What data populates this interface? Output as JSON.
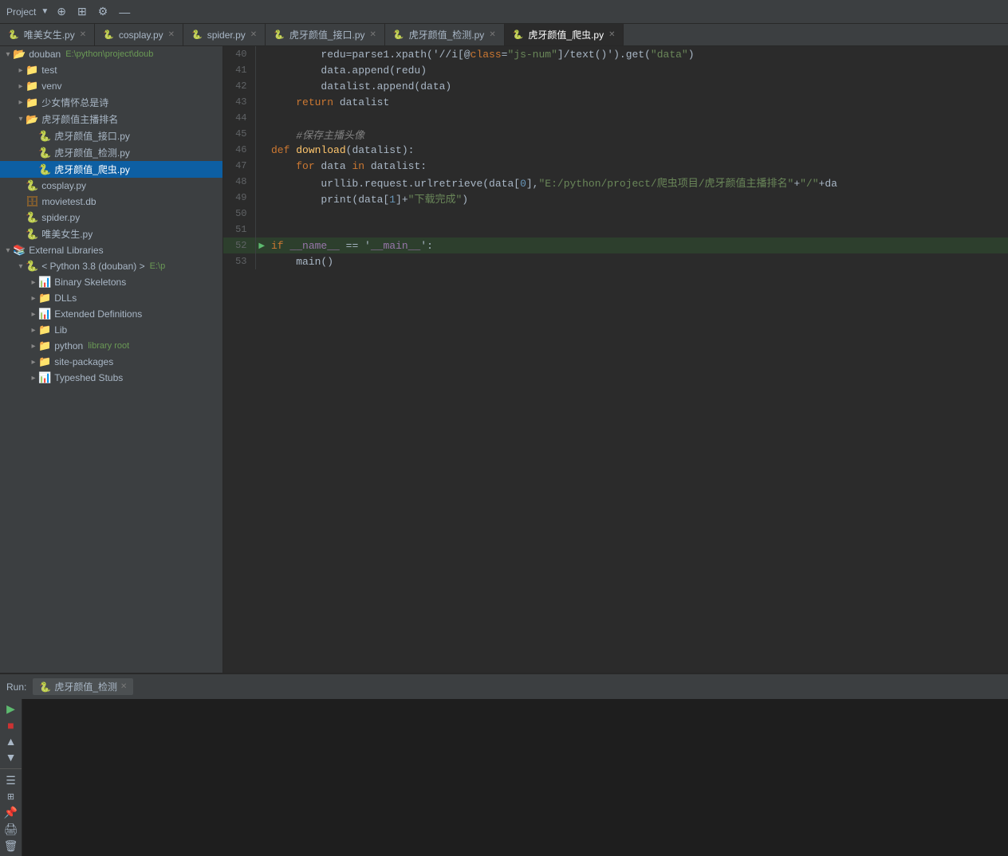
{
  "topbar": {
    "project_label": "Project",
    "icons": [
      "⊕",
      "⊞",
      "⚙",
      "—"
    ]
  },
  "tabs": [
    {
      "label": "唯美女生.py",
      "active": false,
      "icon": "🐍"
    },
    {
      "label": "cosplay.py",
      "active": false,
      "icon": "🐍"
    },
    {
      "label": "spider.py",
      "active": false,
      "icon": "🐍"
    },
    {
      "label": "虎牙颜值_接口.py",
      "active": false,
      "icon": "🐍"
    },
    {
      "label": "虎牙颜值_检测.py",
      "active": false,
      "icon": "🐍"
    },
    {
      "label": "虎牙颜值_爬虫.py",
      "active": true,
      "icon": "🐍"
    }
  ],
  "sidebar": {
    "items": [
      {
        "id": "douban",
        "label": "douban",
        "sublabel": "E:\\python\\project\\doub",
        "level": 0,
        "expanded": true,
        "type": "folder",
        "selected": false
      },
      {
        "id": "test",
        "label": "test",
        "sublabel": "",
        "level": 1,
        "expanded": false,
        "type": "folder",
        "selected": false
      },
      {
        "id": "venv",
        "label": "venv",
        "sublabel": "",
        "level": 1,
        "expanded": false,
        "type": "folder",
        "selected": false
      },
      {
        "id": "girl",
        "label": "少女情怀总是诗",
        "sublabel": "",
        "level": 1,
        "expanded": false,
        "type": "folder",
        "selected": false
      },
      {
        "id": "huya-rank",
        "label": "虎牙颜值主播排名",
        "sublabel": "",
        "level": 1,
        "expanded": true,
        "type": "folder",
        "selected": false
      },
      {
        "id": "huya-api",
        "label": "虎牙颜值_接口.py",
        "sublabel": "",
        "level": 2,
        "expanded": false,
        "type": "py",
        "selected": false
      },
      {
        "id": "huya-detect",
        "label": "虎牙颜值_检测.py",
        "sublabel": "",
        "level": 2,
        "expanded": false,
        "type": "py",
        "selected": false
      },
      {
        "id": "huya-spider",
        "label": "虎牙颜值_爬虫.py",
        "sublabel": "",
        "level": 2,
        "expanded": false,
        "type": "py",
        "selected": true
      },
      {
        "id": "cosplay",
        "label": "cosplay.py",
        "sublabel": "",
        "level": 1,
        "expanded": false,
        "type": "py",
        "selected": false
      },
      {
        "id": "movietest",
        "label": "movietest.db",
        "sublabel": "",
        "level": 1,
        "expanded": false,
        "type": "db",
        "selected": false
      },
      {
        "id": "spider",
        "label": "spider.py",
        "sublabel": "",
        "level": 1,
        "expanded": false,
        "type": "py",
        "selected": false
      },
      {
        "id": "meinv",
        "label": "唯美女生.py",
        "sublabel": "",
        "level": 1,
        "expanded": false,
        "type": "py",
        "selected": false
      },
      {
        "id": "ext-lib",
        "label": "External Libraries",
        "sublabel": "",
        "level": 0,
        "expanded": true,
        "type": "extlib",
        "selected": false
      },
      {
        "id": "python38",
        "label": "< Python 3.8 (douban) >",
        "sublabel": "E:\\p",
        "level": 1,
        "expanded": true,
        "type": "python",
        "selected": false
      },
      {
        "id": "bin-skel",
        "label": "Binary Skeletons",
        "sublabel": "",
        "level": 2,
        "expanded": false,
        "type": "folder-bar",
        "selected": false
      },
      {
        "id": "dlls",
        "label": "DLLs",
        "sublabel": "",
        "level": 2,
        "expanded": false,
        "type": "folder",
        "selected": false
      },
      {
        "id": "ext-def",
        "label": "Extended Definitions",
        "sublabel": "",
        "level": 2,
        "expanded": false,
        "type": "folder-bar",
        "selected": false
      },
      {
        "id": "lib",
        "label": "Lib",
        "sublabel": "",
        "level": 2,
        "expanded": false,
        "type": "folder",
        "selected": false
      },
      {
        "id": "python-lib",
        "label": "python",
        "sublabel": "library root",
        "level": 2,
        "expanded": false,
        "type": "folder",
        "selected": false
      },
      {
        "id": "site-packages",
        "label": "site-packages",
        "sublabel": "",
        "level": 2,
        "expanded": false,
        "type": "folder",
        "selected": false
      },
      {
        "id": "typeshed",
        "label": "Typeshed Stubs",
        "sublabel": "",
        "level": 2,
        "expanded": false,
        "type": "folder-bar",
        "selected": false
      }
    ]
  },
  "code": {
    "lines": [
      {
        "num": 40,
        "arrow": "",
        "content": "        redu=parse1.xpath('//i[@class=\"js-num\"]/text()').get(\"data\")",
        "highlight": false
      },
      {
        "num": 41,
        "arrow": "",
        "content": "        data.append(redu)",
        "highlight": false
      },
      {
        "num": 42,
        "arrow": "",
        "content": "        datalist.append(data)",
        "highlight": false
      },
      {
        "num": 43,
        "arrow": "",
        "content": "    return datalist",
        "highlight": false
      },
      {
        "num": 44,
        "arrow": "",
        "content": "",
        "highlight": false
      },
      {
        "num": 45,
        "arrow": "",
        "content": "    #保存主播头像",
        "highlight": false,
        "is_comment": true
      },
      {
        "num": 46,
        "arrow": "",
        "content": "def download(datalist):",
        "highlight": false
      },
      {
        "num": 47,
        "arrow": "",
        "content": "    for data in datalist:",
        "highlight": false
      },
      {
        "num": 48,
        "arrow": "",
        "content": "        urllib.request.urlretrieve(data[0],\"E:/python/project/爬虫项目/虎牙颜值主播排名\"+\"/\"+da",
        "highlight": false
      },
      {
        "num": 49,
        "arrow": "",
        "content": "        print(data[1]+\"下载完成\")",
        "highlight": false
      },
      {
        "num": 50,
        "arrow": "",
        "content": "",
        "highlight": false
      },
      {
        "num": 51,
        "arrow": "",
        "content": "",
        "highlight": false
      },
      {
        "num": 52,
        "arrow": "▶",
        "content": "if __name__ == '__main__':",
        "highlight": true
      },
      {
        "num": 53,
        "arrow": "",
        "content": "    main()",
        "highlight": false
      }
    ]
  },
  "run": {
    "label": "Run:",
    "tab_label": "虎牙颜值_检测",
    "tab_icon": "🐍"
  },
  "run_toolbar": {
    "buttons": [
      "▶",
      "■",
      "▲",
      "▼",
      "≡",
      "⊞",
      "📌",
      "🖨",
      "🗑"
    ]
  }
}
